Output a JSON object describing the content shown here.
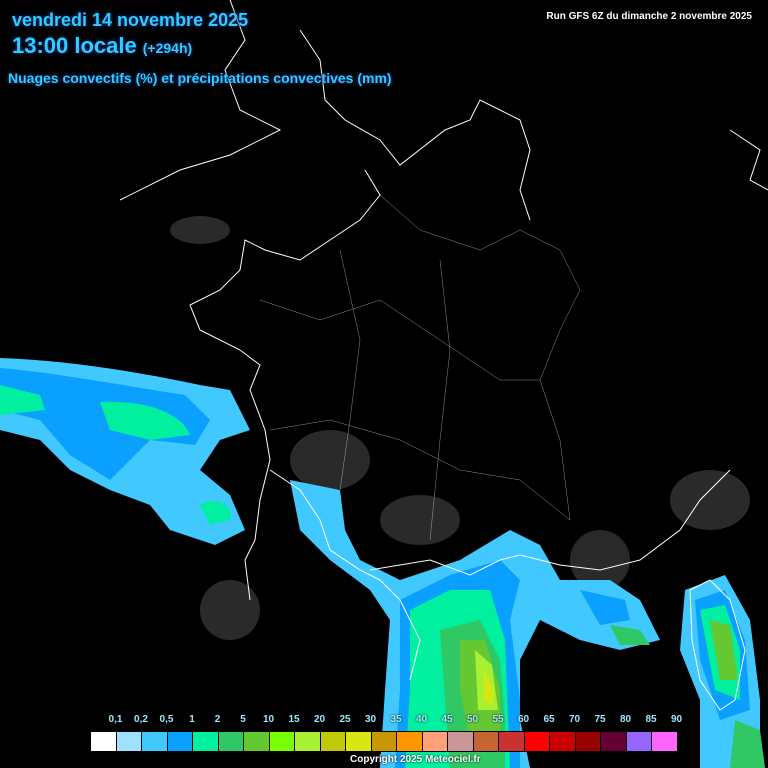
{
  "header": {
    "date": "vendredi 14 novembre 2025",
    "time": "13:00 locale",
    "lead": "(+294h)",
    "subtitle": "Nuages convectifs (%) et précipitations convectives (mm)",
    "run": "Run GFS 6Z du dimanche 2 novembre 2025"
  },
  "legend": {
    "labels": [
      "0,1",
      "0,2",
      "0,5",
      "1",
      "2",
      "5",
      "10",
      "15",
      "20",
      "25",
      "30",
      "35",
      "40",
      "45",
      "50",
      "55",
      "60",
      "65",
      "70",
      "75",
      "80",
      "85",
      "90"
    ],
    "colors": [
      "#ffffff",
      "#a0e0ff",
      "#40c8ff",
      "#0aa0ff",
      "#00f0a0",
      "#30c864",
      "#64c832",
      "#78ff00",
      "#a8f032",
      "#c0c80a",
      "#d8e614",
      "#c89600",
      "#ff9600",
      "#ffa078",
      "#c89696",
      "#c86432",
      "#c83232",
      "#ff0000",
      "#c80000",
      "#960000",
      "#640032",
      "#9664ff",
      "#ff64ff"
    ]
  },
  "copyright": "Copyright 2025 Meteociel.fr"
}
